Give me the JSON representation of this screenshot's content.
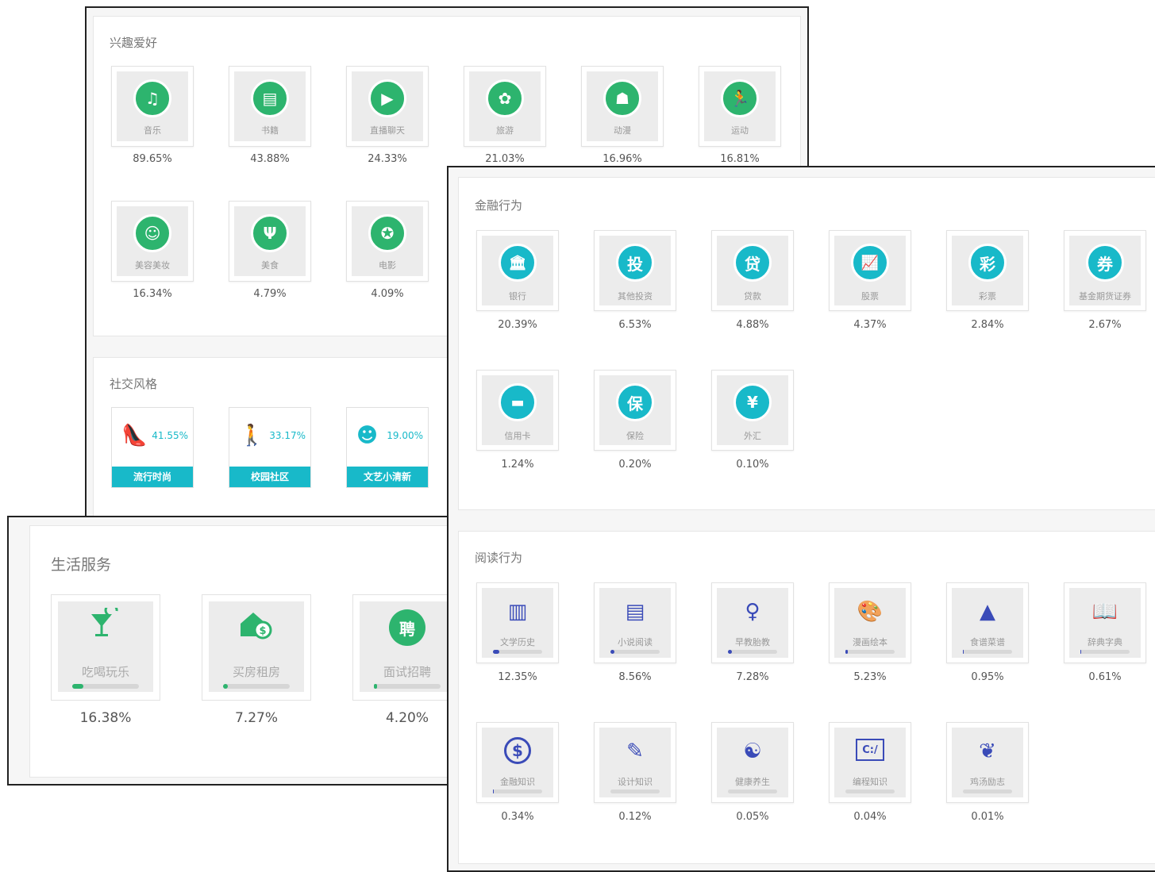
{
  "interests": {
    "title": "兴趣爱好",
    "items": [
      {
        "label": "音乐",
        "pct": "89.65%",
        "icon": "music-icon"
      },
      {
        "label": "书籍",
        "pct": "43.88%",
        "icon": "book-icon"
      },
      {
        "label": "直播聊天",
        "pct": "24.33%",
        "icon": "video-chat-icon"
      },
      {
        "label": "旅游",
        "pct": "21.03%",
        "icon": "palm-tree-icon"
      },
      {
        "label": "动漫",
        "pct": "16.96%",
        "icon": "anime-mask-icon"
      },
      {
        "label": "运动",
        "pct": "16.81%",
        "icon": "running-icon"
      },
      {
        "label": "美容美妆",
        "pct": "16.34%",
        "icon": "face-mask-icon"
      },
      {
        "label": "美食",
        "pct": "4.79%",
        "icon": "fork-knife-icon"
      },
      {
        "label": "电影",
        "pct": "4.09%",
        "icon": "film-reel-icon"
      }
    ]
  },
  "social": {
    "title": "社交风格",
    "items": [
      {
        "label": "流行时尚",
        "pct": "41.55%",
        "icon": "high-heel-icon"
      },
      {
        "label": "校园社区",
        "pct": "33.17%",
        "icon": "walking-people-icon"
      },
      {
        "label": "文艺小清新",
        "pct": "19.00%",
        "icon": "girl-avatar-icon"
      }
    ]
  },
  "life": {
    "title": "生活服务",
    "items": [
      {
        "label": "吃喝玩乐",
        "pct": "16.38%",
        "icon": "cocktail-icon",
        "fill": 16.38
      },
      {
        "label": "买房租房",
        "pct": "7.27%",
        "icon": "house-dollar-icon",
        "fill": 7.27
      },
      {
        "label": "面试招聘",
        "pct": "4.20%",
        "icon": "hire-icon",
        "icon_text": "聘",
        "fill": 4.2
      }
    ]
  },
  "finance": {
    "title": "金融行为",
    "items": [
      {
        "label": "银行",
        "pct": "20.39%",
        "icon": "bank-icon",
        "icon_text": ""
      },
      {
        "label": "其他投资",
        "pct": "6.53%",
        "icon": "invest-icon",
        "icon_text": "投"
      },
      {
        "label": "贷款",
        "pct": "4.88%",
        "icon": "loan-icon",
        "icon_text": "贷"
      },
      {
        "label": "股票",
        "pct": "4.37%",
        "icon": "stock-chart-icon",
        "icon_text": ""
      },
      {
        "label": "彩票",
        "pct": "2.84%",
        "icon": "lottery-icon",
        "icon_text": "彩"
      },
      {
        "label": "基金期货证券",
        "pct": "2.67%",
        "icon": "fund-icon",
        "icon_text": "券"
      },
      {
        "label": "信用卡",
        "pct": "1.24%",
        "icon": "credit-card-icon",
        "icon_text": ""
      },
      {
        "label": "保险",
        "pct": "0.20%",
        "icon": "insurance-icon",
        "icon_text": "保"
      },
      {
        "label": "外汇",
        "pct": "0.10%",
        "icon": "forex-icon",
        "icon_text": "¥"
      }
    ]
  },
  "reading": {
    "title": "阅读行为",
    "items": [
      {
        "label": "文学历史",
        "pct": "12.35%",
        "icon": "bookshelf-icon",
        "fill": 12.35
      },
      {
        "label": "小说阅读",
        "pct": "8.56%",
        "icon": "novel-icon",
        "fill": 8.56
      },
      {
        "label": "早教胎教",
        "pct": "7.28%",
        "icon": "pregnancy-icon",
        "fill": 7.28
      },
      {
        "label": "漫画绘本",
        "pct": "5.23%",
        "icon": "palette-icon",
        "fill": 5.23
      },
      {
        "label": "食谱菜谱",
        "pct": "0.95%",
        "icon": "food-cloche-icon",
        "fill": 0.95
      },
      {
        "label": "辞典字典",
        "pct": "0.61%",
        "icon": "dictionary-icon",
        "fill": 0.61
      },
      {
        "label": "金融知识",
        "pct": "0.34%",
        "icon": "dollar-coin-icon",
        "fill": 0.34
      },
      {
        "label": "设计知识",
        "pct": "0.12%",
        "icon": "design-tools-icon",
        "fill": 0.12
      },
      {
        "label": "健康养生",
        "pct": "0.05%",
        "icon": "meditation-icon",
        "fill": 0.05
      },
      {
        "label": "编程知识",
        "pct": "0.04%",
        "icon": "terminal-icon",
        "fill": 0.04
      },
      {
        "label": "鸡汤励志",
        "pct": "0.01%",
        "icon": "sprout-icon",
        "fill": 0.01
      }
    ]
  },
  "colors": {
    "green": "#2db46e",
    "teal": "#18b9c9",
    "indigo": "#3a4bb8"
  }
}
